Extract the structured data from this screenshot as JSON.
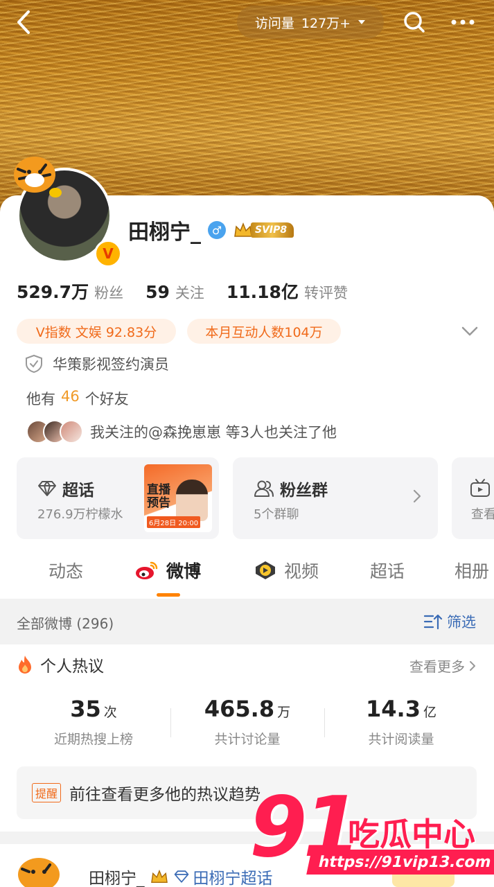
{
  "header": {
    "visit_label": "访问量",
    "visit_count": "127万+"
  },
  "profile": {
    "name": "田栩宁_",
    "gender_symbol": "♂",
    "svip_label": "SVIP8",
    "verified_v": "V",
    "stats": [
      {
        "num": "529.7万",
        "label": "粉丝"
      },
      {
        "num": "59",
        "label": "关注"
      },
      {
        "num": "11.18亿",
        "label": "转评赞"
      }
    ],
    "v_index": "V指数 文娱 92.83分",
    "monthly_interaction": "本月互动人数104万",
    "verification": "华策影视签约演员",
    "friends_prefix": "他有",
    "friends_count": "46",
    "friends_suffix": "个好友",
    "mutual_follow": "我关注的@森挽崽崽 等3人也关注了他"
  },
  "features": {
    "chaohua": {
      "title": "超话",
      "sub": "276.9万柠檬水"
    },
    "promo": {
      "text": "直播预告",
      "date": "6月28日 20:00"
    },
    "fans_group": {
      "title": "粉丝群",
      "sub": "5个群聊"
    },
    "third": {
      "sub": "查看"
    }
  },
  "tabs": [
    {
      "label": "动态"
    },
    {
      "label": "微博"
    },
    {
      "label": "视频"
    },
    {
      "label": "超话"
    },
    {
      "label": "相册"
    }
  ],
  "filter": {
    "all_posts": "全部微博 (296)",
    "filter_label": "筛选"
  },
  "hot": {
    "title": "个人热议",
    "see_more": "查看更多",
    "stats": [
      {
        "value": "35",
        "unit": "次",
        "label": "近期热搜上榜"
      },
      {
        "value": "465.8",
        "unit": "万",
        "label": "共计讨论量"
      },
      {
        "value": "14.3",
        "unit": "亿",
        "label": "共计阅读量"
      }
    ],
    "reminder_tag": "提醒",
    "reminder_text": "前往查看更多他的热议趋势"
  },
  "post": {
    "name": "田栩宁_",
    "chaohua_link": "田栩宁超话"
  },
  "watermark": {
    "brand_num": "91",
    "brand_cn": "吃瓜中心",
    "url": "https://91vip13.com"
  },
  "colors": {
    "accent_orange": "#ff8200",
    "link_blue": "#3a6bb5",
    "pill_text": "#f06a1a"
  }
}
